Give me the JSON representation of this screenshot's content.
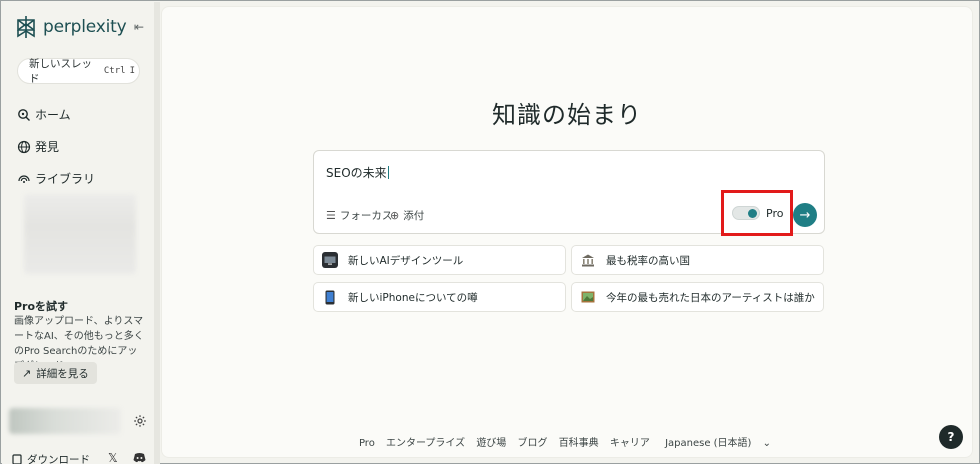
{
  "app": {
    "name": "perplexity"
  },
  "sidebar": {
    "new_thread": {
      "label": "新しいスレッド",
      "shortcut_keys": [
        "Ctrl",
        "I"
      ]
    },
    "nav": [
      {
        "label": "ホーム",
        "icon": "home-search-icon"
      },
      {
        "label": "発見",
        "icon": "globe-icon"
      },
      {
        "label": "ライブラリ",
        "icon": "library-icon"
      }
    ],
    "pro_promo": {
      "title": "Proを試す",
      "description": "画像アップロード、よりスマートなAI、その他もっと多くのPro Searchのためにアップグレード。",
      "button": "詳細を見る"
    },
    "download": "ダウンロード"
  },
  "main": {
    "headline": "知識の始まり",
    "search": {
      "query": "SEOの未来",
      "focus_label": "フォーカス",
      "attach_label": "添付",
      "pro_label": "Pro",
      "pro_enabled": true
    },
    "suggestions": [
      {
        "label": "新しいAIデザインツール",
        "icon": "monitor-icon"
      },
      {
        "label": "最も税率の高い国",
        "icon": "bank-icon"
      },
      {
        "label": "新しいiPhoneについての噂",
        "icon": "phone-icon"
      },
      {
        "label": "今年の最も売れた日本のアーティストは誰か",
        "icon": "picture-icon"
      }
    ],
    "footer": [
      "Pro",
      "エンタープライズ",
      "遊び場",
      "ブログ",
      "百科事典",
      "キャリア",
      "Japanese (日本語)"
    ],
    "help": "?"
  },
  "colors": {
    "accent": "#1f7e85",
    "highlight": "#e21a1a",
    "background": "#f3f3ee"
  }
}
